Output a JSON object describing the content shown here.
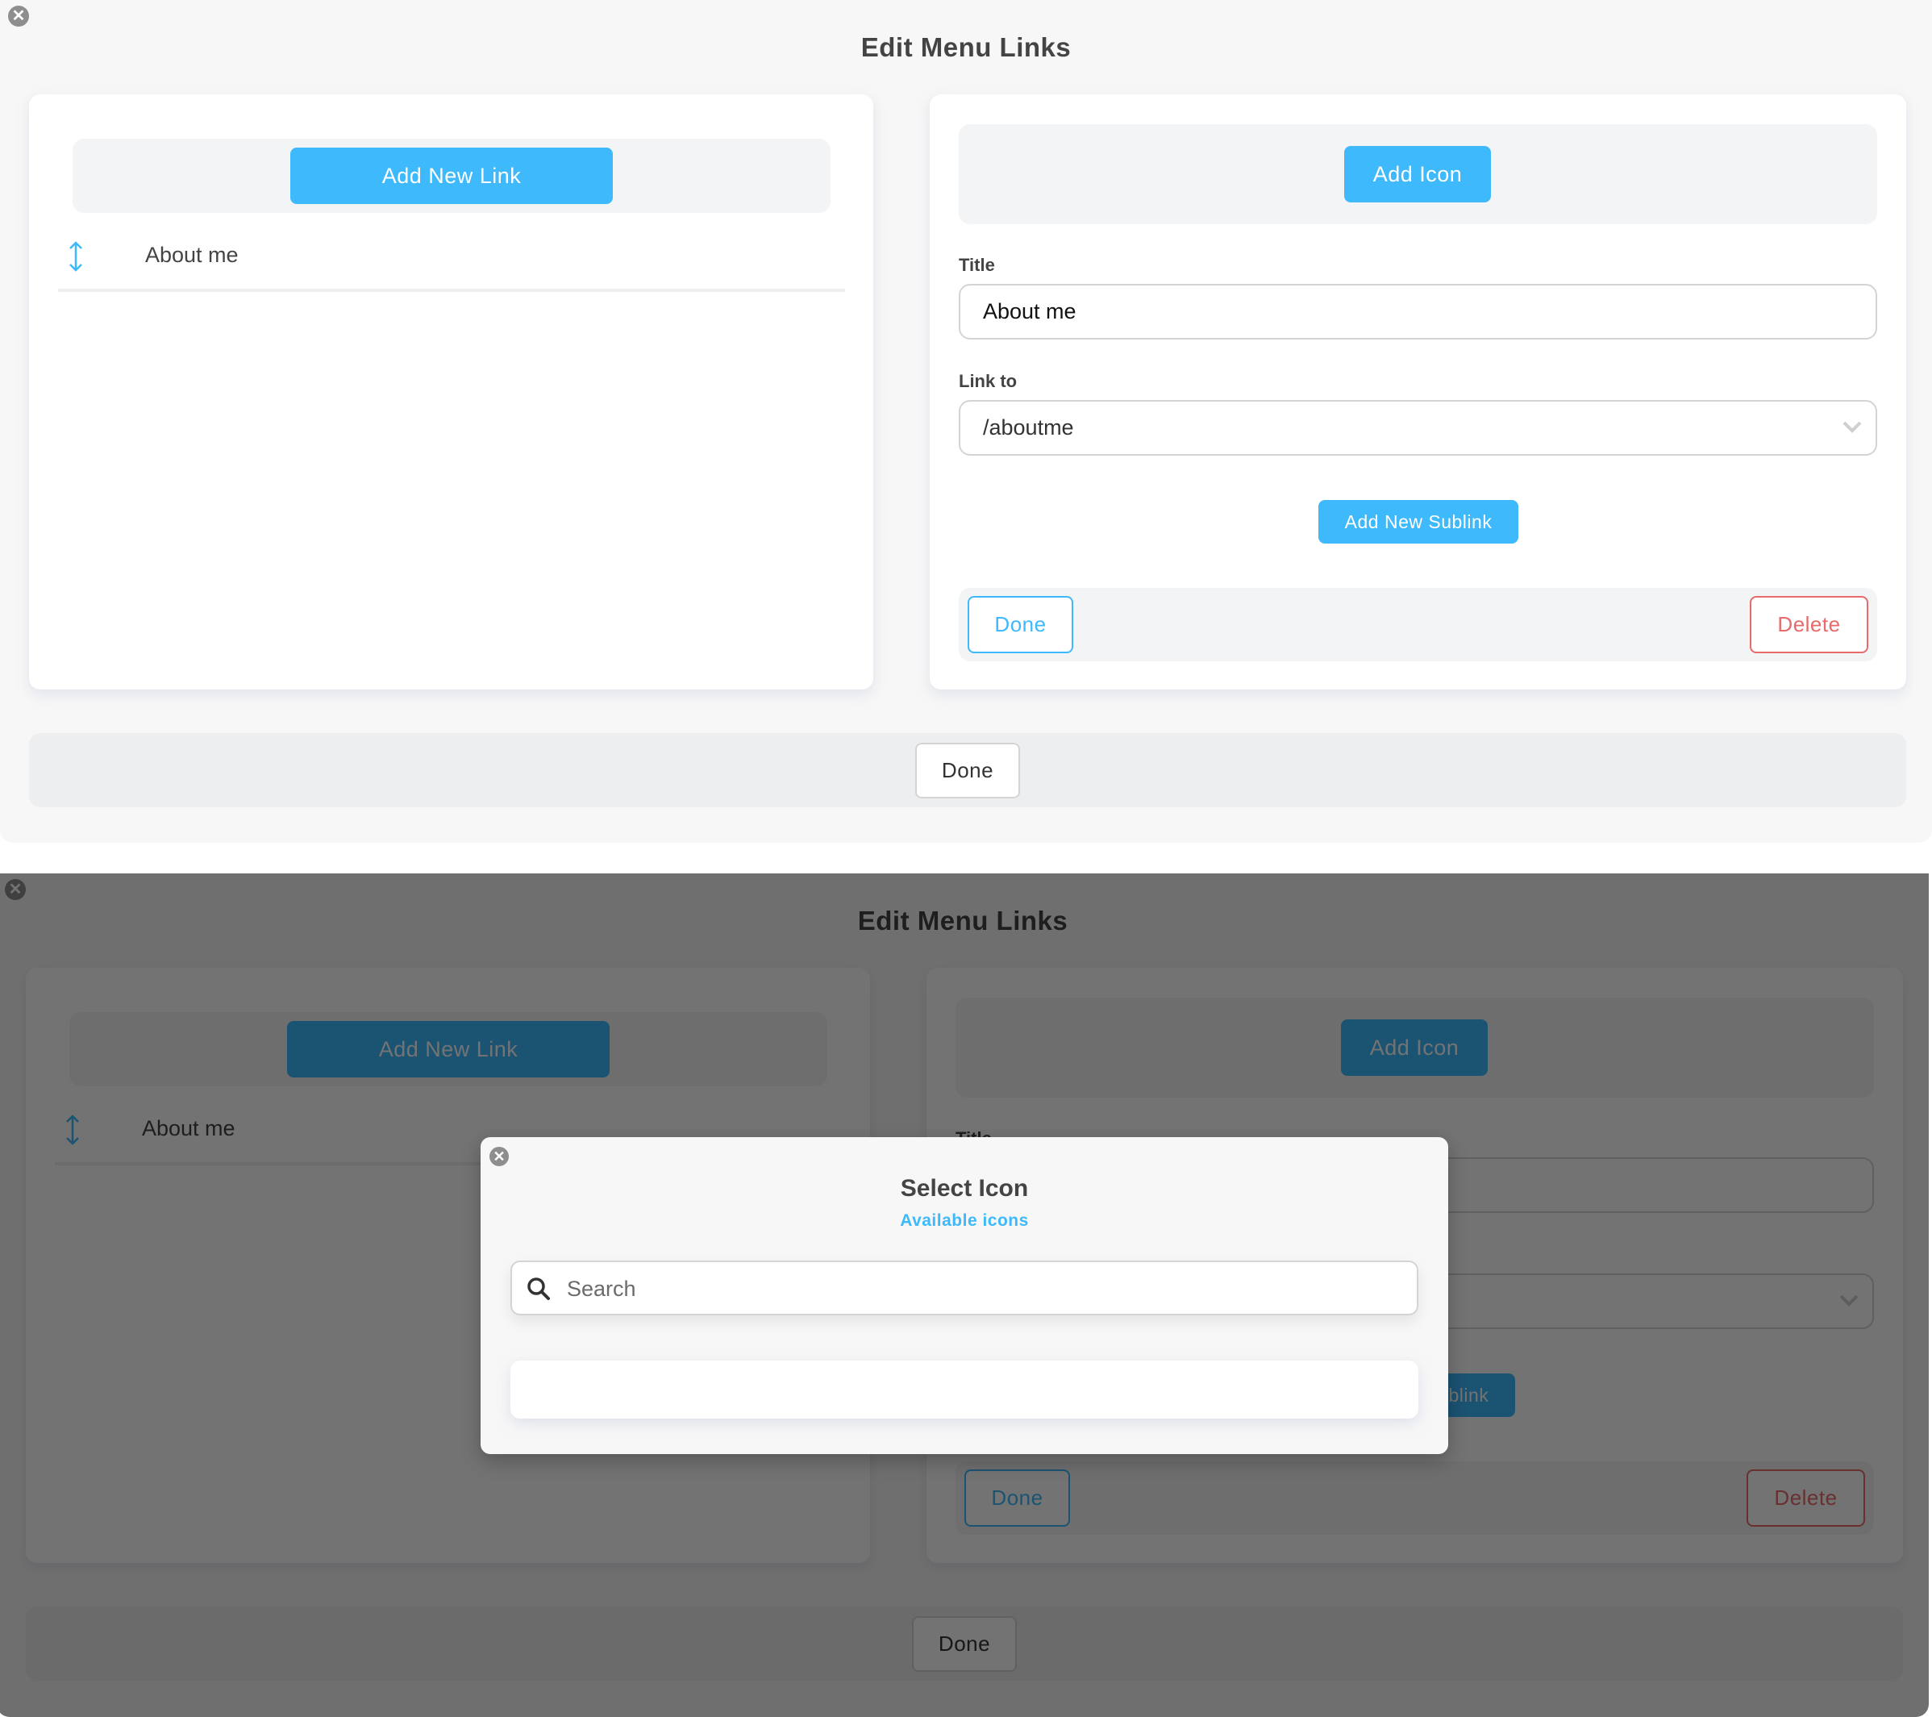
{
  "dialog": {
    "title": "Edit Menu Links",
    "close_icon": "close-circle-icon",
    "links_panel": {
      "add_link_label": "Add New Link",
      "items": [
        {
          "label": "About me",
          "icon": "drag-vertical-arrows-icon"
        }
      ]
    },
    "editor_panel": {
      "add_icon_label": "Add Icon",
      "title_label": "Title",
      "title_value": "About me",
      "link_label": "Link to",
      "link_value": "/aboutme",
      "add_sublink_label": "Add New Sublink",
      "done_label": "Done",
      "delete_label": "Delete"
    },
    "footer": {
      "done_label": "Done"
    }
  },
  "modal": {
    "title": "Select Icon",
    "subtitle_link": "Available icons",
    "search_placeholder": "Search",
    "search_value": "",
    "close_icon": "close-circle-icon",
    "search_icon": "magnifier-icon"
  },
  "colors": {
    "accent": "#3db9fc",
    "danger": "#e86a6a",
    "panel_bg": "#ffffff",
    "dialog_bg": "#f7f7f7",
    "subtle_bg": "#f3f4f6",
    "overlay": "rgba(0,0,0,0.55)"
  }
}
